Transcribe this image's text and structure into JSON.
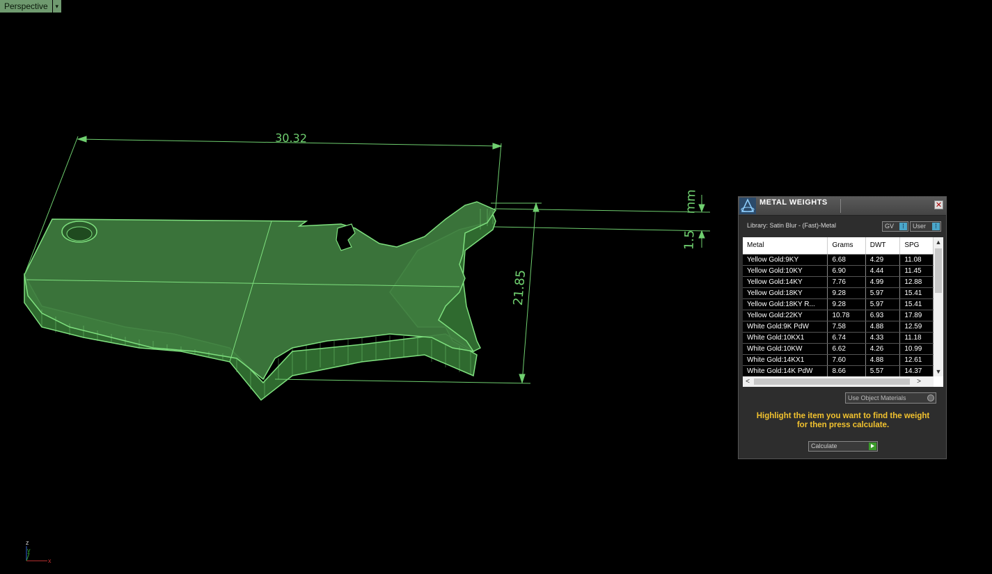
{
  "viewport": {
    "name": "Perspective",
    "dropdown_glyph": "▾"
  },
  "dimensions": {
    "width": "30.32",
    "height": "21.85",
    "thickness": "1.5",
    "unit": "mm"
  },
  "axis": {
    "z": "z",
    "y": "y",
    "x": "x"
  },
  "colors": {
    "model_fill": "#3f7d3f",
    "model_edge": "#7ee07e",
    "hint_text": "#f2c22e",
    "calc_button": "#3a9a2a"
  },
  "panel": {
    "title": "METAL WEIGHTS",
    "close_glyph": "✕",
    "library_label": "Library: Satin Blur - (Fast)-Metal",
    "select_gv": "GV",
    "select_user": "User",
    "table": {
      "headers": [
        "Metal",
        "Grams",
        "DWT",
        "SPG"
      ],
      "rows": [
        [
          "Yellow Gold:9KY",
          "6.68",
          "4.29",
          "11.08"
        ],
        [
          "Yellow Gold:10KY",
          "6.90",
          "4.44",
          "11.45"
        ],
        [
          "Yellow Gold:14KY",
          "7.76",
          "4.99",
          "12.88"
        ],
        [
          "Yellow Gold:18KY",
          "9.28",
          "5.97",
          "15.41"
        ],
        [
          "Yellow Gold:18KY R...",
          "9.28",
          "5.97",
          "15.41"
        ],
        [
          "Yellow Gold:22KY",
          "10.78",
          "6.93",
          "17.89"
        ],
        [
          "White Gold:9K PdW",
          "7.58",
          "4.88",
          "12.59"
        ],
        [
          "White Gold:10KX1",
          "6.74",
          "4.33",
          "11.18"
        ],
        [
          "White Gold:10KW",
          "6.62",
          "4.26",
          "10.99"
        ],
        [
          "White Gold:14KX1",
          "7.60",
          "4.88",
          "12.61"
        ],
        [
          "White Gold:14K PdW",
          "8.66",
          "5.57",
          "14.37"
        ]
      ]
    },
    "use_object_materials": "Use Object Materials",
    "hint_line1": "Highlight the item you want to find the weight",
    "hint_line2": "for then press calculate.",
    "calculate_label": "Calculate"
  }
}
